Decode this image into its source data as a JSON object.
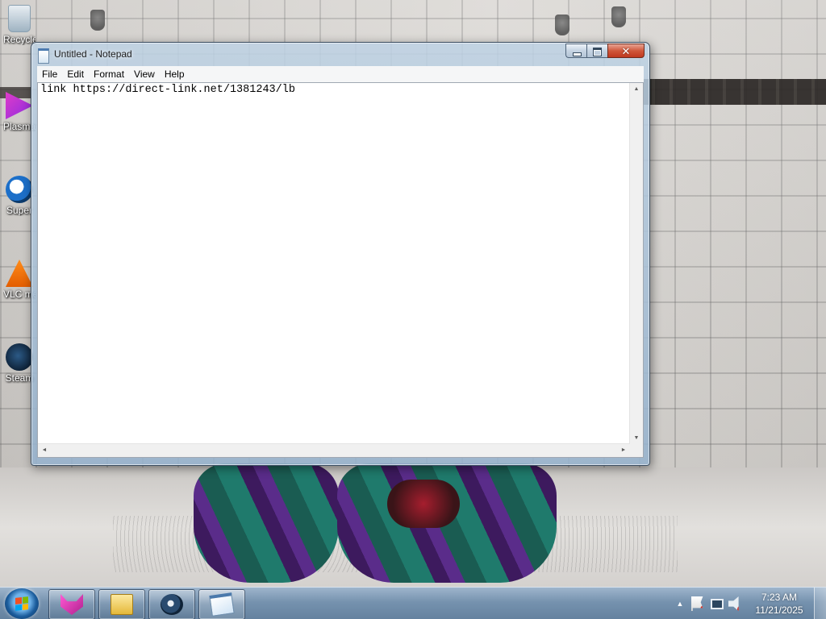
{
  "desktop": {
    "icons": [
      {
        "label": "Recycle Bin",
        "icon": "recycle-bin-icon"
      },
      {
        "label": "Plasma",
        "icon": "plasma-icon"
      },
      {
        "label": "Super",
        "icon": "super-icon"
      },
      {
        "label": "VLC media player",
        "icon": "vlc-icon"
      },
      {
        "label": "Steam",
        "icon": "steam-icon"
      }
    ]
  },
  "notepad": {
    "title": "Untitled - Notepad",
    "caption_buttons": {
      "minimize": "minimize-icon",
      "maximize": "maximize-icon",
      "close": "✕"
    },
    "menu": [
      "File",
      "Edit",
      "Format",
      "View",
      "Help"
    ],
    "content": "link https://direct-link.net/1381243/lb",
    "scroll_arrows": {
      "up": "▲",
      "down": "▼",
      "left": "◄",
      "right": "►"
    }
  },
  "taskbar": {
    "pinned": [
      {
        "name": "fox-app",
        "icon": "fox-icon"
      },
      {
        "name": "file-explorer",
        "icon": "folder-icon"
      },
      {
        "name": "steam",
        "icon": "steam-icon"
      },
      {
        "name": "notepad",
        "icon": "notepad-icon",
        "active": true
      }
    ],
    "tray": {
      "expand_arrow": "▲",
      "icons": [
        "action-center-flag-icon",
        "network-icon",
        "volume-muted-icon"
      ],
      "error_badge": "✕"
    },
    "clock": {
      "time": "7:23 AM",
      "date": "11/21/2025"
    }
  },
  "colors": {
    "window_glass": "#a6bfd6",
    "close_button": "#c7432a",
    "taskbar": "#6e8caa"
  }
}
